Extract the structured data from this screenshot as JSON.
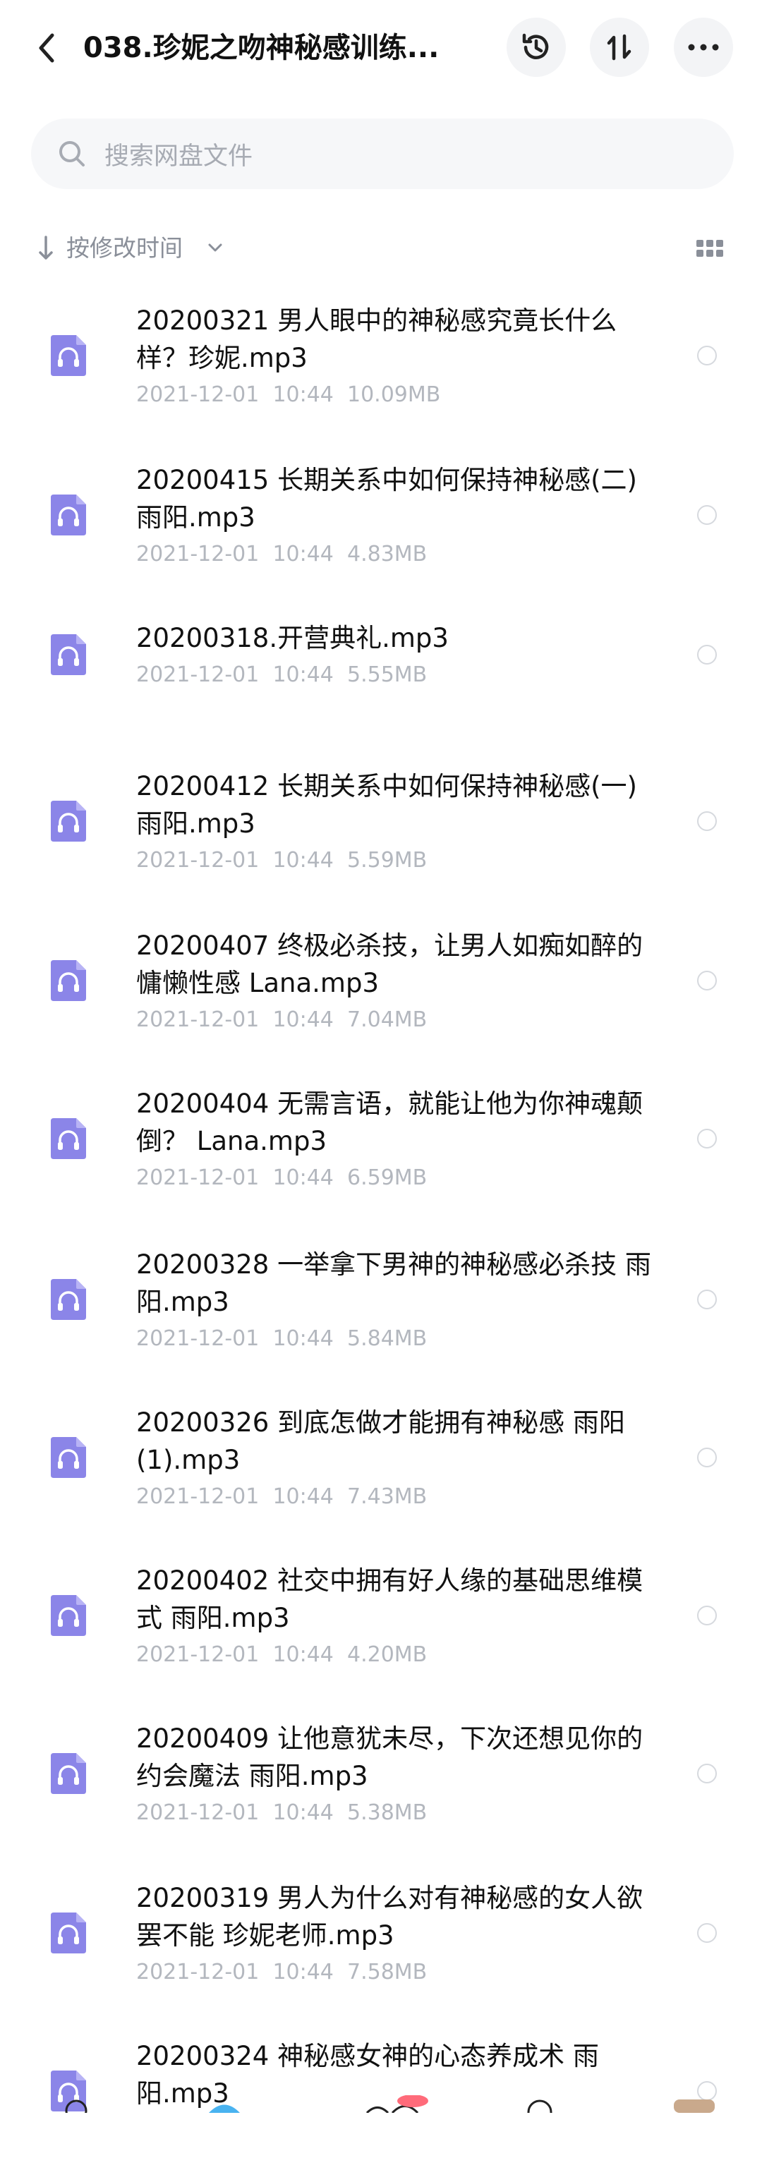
{
  "header": {
    "title": "038.珍妮之吻神秘感训练...",
    "back_icon": "chevron-left-icon",
    "history_icon": "history-icon",
    "sort_icon": "sort-updown-icon",
    "more_icon": "more-dots-icon"
  },
  "search": {
    "placeholder": "搜索网盘文件",
    "icon": "search-icon"
  },
  "sort": {
    "label": "按修改时间",
    "direction_icon": "arrow-down-icon",
    "dropdown_icon": "chevron-down-icon",
    "view_icon": "grid-view-icon"
  },
  "colors": {
    "file_icon": "#8b85e8",
    "meta_text": "#b3b7be",
    "accent_bottom": "#ff6b7a"
  },
  "files": [
    {
      "name": "20200321 男人眼中的神秘感究竟长什么样？珍妮.mp3",
      "date": "2021-12-01",
      "time": "10:44",
      "size": "10.09MB"
    },
    {
      "name": "20200415 长期关系中如何保持神秘感(二) 雨阳.mp3",
      "date": "2021-12-01",
      "time": "10:44",
      "size": "4.83MB"
    },
    {
      "name": "20200318.开营典礼.mp3",
      "date": "2021-12-01",
      "time": "10:44",
      "size": "5.55MB"
    },
    {
      "name": "20200412 长期关系中如何保持神秘感(一) 雨阳.mp3",
      "date": "2021-12-01",
      "time": "10:44",
      "size": "5.59MB"
    },
    {
      "name": "20200407 终极必杀技，让男人如痴如醉的慵懒性感 Lana.mp3",
      "date": "2021-12-01",
      "time": "10:44",
      "size": "7.04MB"
    },
    {
      "name": "20200404 无需言语，就能让他为你神魂颠倒？ Lana.mp3",
      "date": "2021-12-01",
      "time": "10:44",
      "size": "6.59MB"
    },
    {
      "name": "20200328 一举拿下男神的神秘感必杀技 雨阳.mp3",
      "date": "2021-12-01",
      "time": "10:44",
      "size": "5.84MB"
    },
    {
      "name": "20200326 到底怎做才能拥有神秘感 雨阳 (1).mp3",
      "date": "2021-12-01",
      "time": "10:44",
      "size": "7.43MB"
    },
    {
      "name": "20200402 社交中拥有好人缘的基础思维模式 雨阳.mp3",
      "date": "2021-12-01",
      "time": "10:44",
      "size": "4.20MB"
    },
    {
      "name": "20200409 让他意犹未尽，下次还想见你的约会魔法 雨阳.mp3",
      "date": "2021-12-01",
      "time": "10:44",
      "size": "5.38MB"
    },
    {
      "name": "20200319 男人为什么对有神秘感的女人欲罢不能 珍妮老师.mp3",
      "date": "2021-12-01",
      "time": "10:44",
      "size": "7.58MB"
    },
    {
      "name": "20200324 神秘感女神的心态养成术 雨阳.mp3",
      "date": "",
      "time": "",
      "size": ""
    }
  ]
}
